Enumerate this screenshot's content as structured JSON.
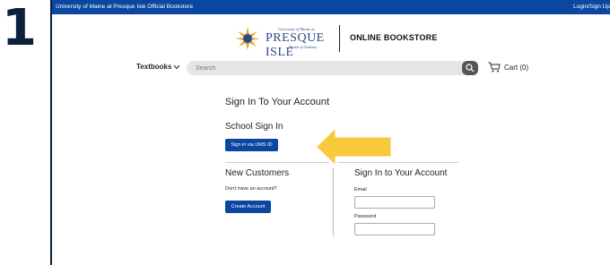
{
  "step": {
    "number": "1"
  },
  "topbar": {
    "store_title": "University of Maine at Presque Isle Official Bookstore",
    "login_label": "Login/Sign Up"
  },
  "brand": {
    "logo_univ": "University of Maine at",
    "logo_name": "PRESQUE ISLE",
    "logo_tagline": "Mantle of Ordinary",
    "store_name": "ONLINE BOOKSTORE",
    "logo_icon": "university-seal-icon"
  },
  "nav": {
    "textbooks_label": "Textbooks",
    "search_placeholder": "Search",
    "cart_label": "Cart (0)"
  },
  "signin": {
    "heading": "Sign In To Your Account",
    "school_heading": "School Sign In",
    "ums_button": "Sign in via UMS ID",
    "new_customers_heading": "New Customers",
    "new_customers_note": "Don't have an account?",
    "create_button": "Create Account",
    "account_heading": "Sign In to Your Account",
    "email_label": "Email",
    "password_label": "Password"
  },
  "colors": {
    "primary_blue": "#0a47a0",
    "callout_yellow": "#f9c93c",
    "step_navy": "#0d1f3c"
  }
}
